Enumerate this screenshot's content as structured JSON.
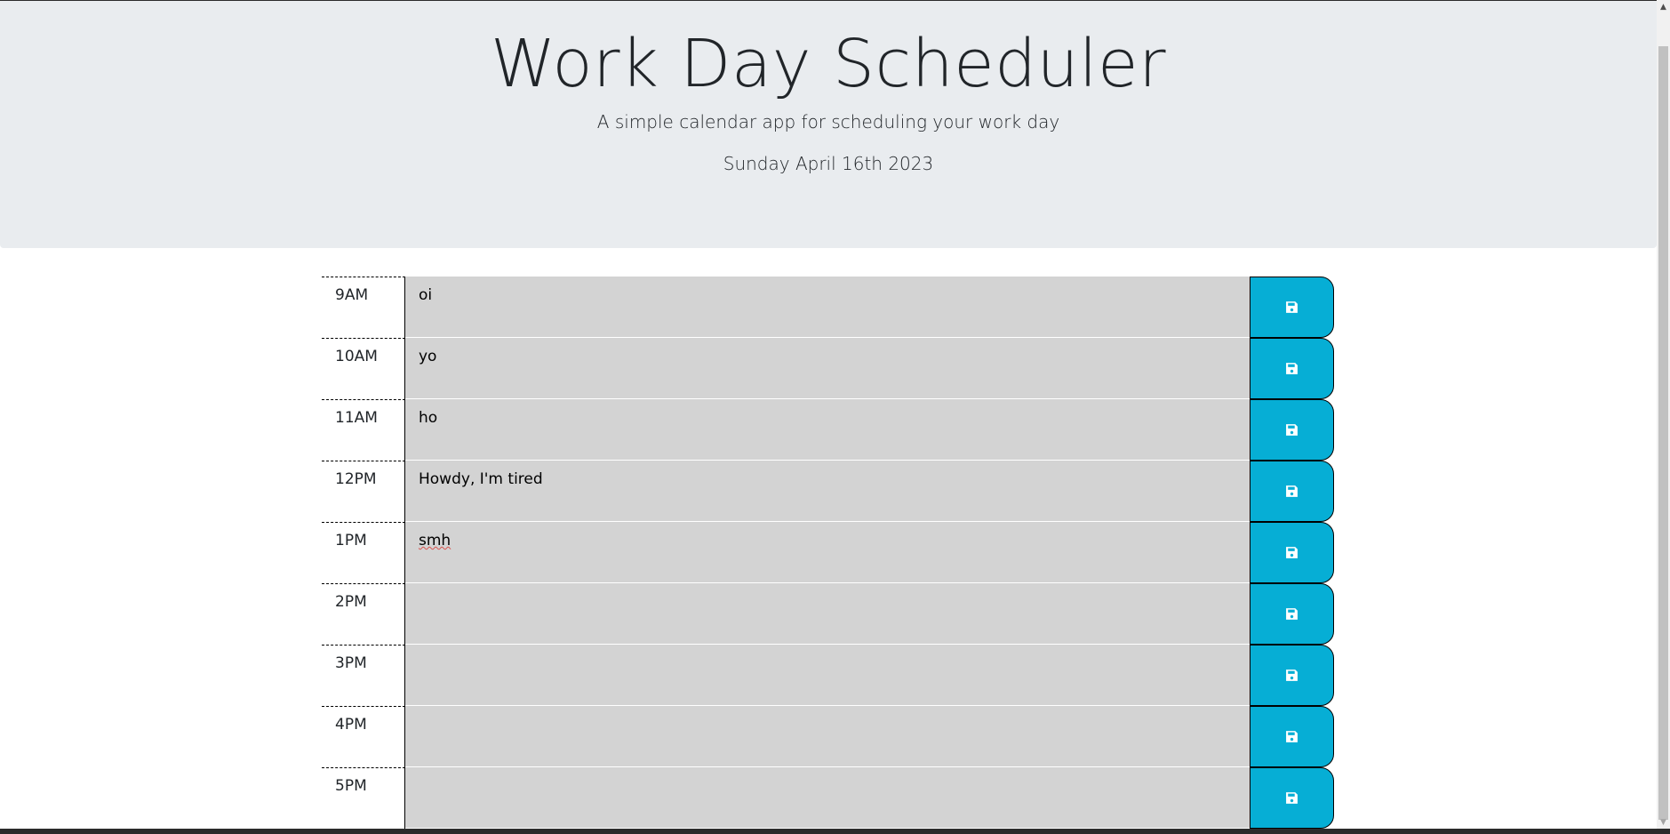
{
  "header": {
    "title": "Work Day Scheduler",
    "lead": "A simple calendar app for scheduling your work day",
    "current_day": "Sunday April 16th 2023"
  },
  "colors": {
    "header_bg": "#e9ecef",
    "description_bg": "#d3d3d3",
    "save_button": "#06aed5",
    "save_icon": "#ffffff"
  },
  "save_button": {
    "icon": "save-icon"
  },
  "time_blocks": [
    {
      "hour": "9AM",
      "text": "oi"
    },
    {
      "hour": "10AM",
      "text": "yo"
    },
    {
      "hour": "11AM",
      "text": "ho"
    },
    {
      "hour": "12PM",
      "text": "Howdy, I'm tired"
    },
    {
      "hour": "1PM",
      "text": "smh"
    },
    {
      "hour": "2PM",
      "text": ""
    },
    {
      "hour": "3PM",
      "text": ""
    },
    {
      "hour": "4PM",
      "text": ""
    },
    {
      "hour": "5PM",
      "text": ""
    }
  ]
}
